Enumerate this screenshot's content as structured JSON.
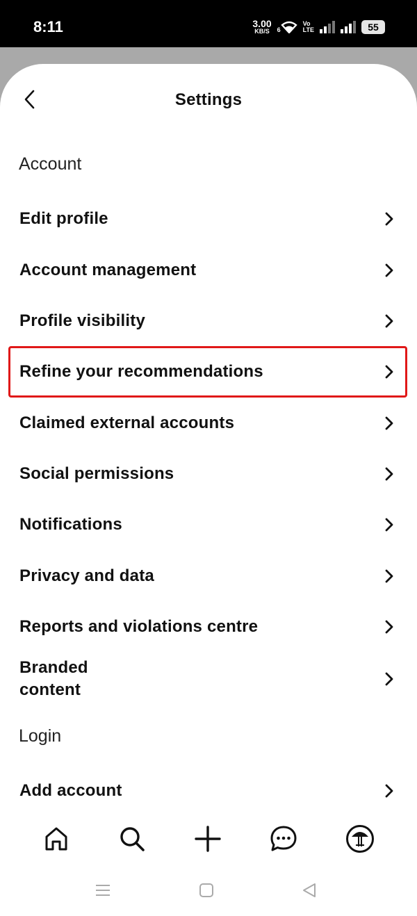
{
  "status_bar": {
    "time": "8:11",
    "net_speed_value": "3.00",
    "net_speed_unit": "KB/S",
    "wifi_label": "6",
    "volte_top": "Vo",
    "volte_bottom": "LTE",
    "battery": "55"
  },
  "header": {
    "title": "Settings"
  },
  "sections": {
    "account": "Account",
    "login": "Login"
  },
  "settings_items": {
    "edit_profile": "Edit profile",
    "account_management": "Account management",
    "profile_visibility": "Profile visibility",
    "refine_recommendations": "Refine your recommendations",
    "claimed_external_accounts": "Claimed external accounts",
    "social_permissions": "Social permissions",
    "notifications": "Notifications",
    "privacy_and_data": "Privacy and data",
    "reports_and_violations": "Reports and violations centre",
    "branded_content_line1": "Branded",
    "branded_content_line2": "content",
    "add_account": "Add account"
  },
  "highlight_color": "#e01818",
  "icons": {
    "back": "back-arrow-icon",
    "chevron": "chevron-right-icon",
    "nav_home": "home-icon",
    "nav_search": "search-icon",
    "nav_create": "plus-icon",
    "nav_messages": "chat-bubble-icon",
    "nav_profile": "profile-avatar-icon"
  }
}
